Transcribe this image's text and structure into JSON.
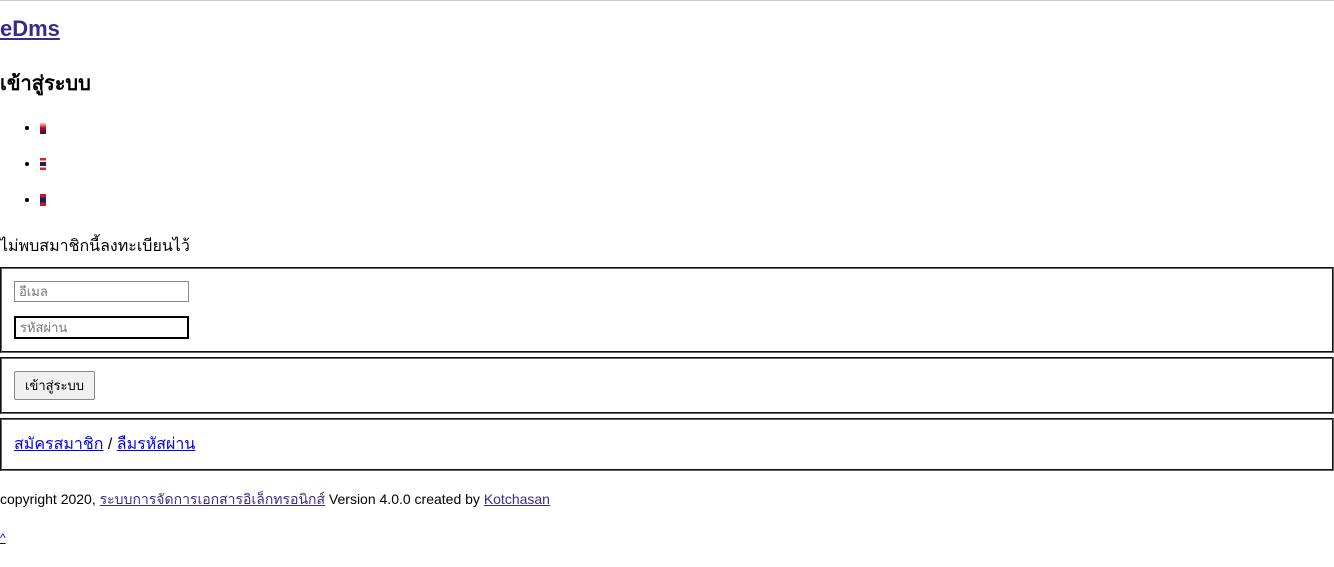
{
  "header": {
    "logo_text": "eDms",
    "page_title": "เข้าสู่ระบบ"
  },
  "languages": {
    "items": [
      {
        "name": "english",
        "flag": "flag-en"
      },
      {
        "name": "thai",
        "flag": "flag-th"
      },
      {
        "name": "lao",
        "flag": "flag-la"
      }
    ]
  },
  "error_message": "ไม่พบสมาชิกนี้ลงทะเบียนไว้",
  "form": {
    "email_placeholder": "อีเมล",
    "password_placeholder": "รหัสผ่าน",
    "login_button": "เข้าสู่ระบบ"
  },
  "links": {
    "register": "สมัครสมาชิก",
    "separator": " / ",
    "forgot": "ลืมรหัสผ่าน"
  },
  "footer": {
    "copyright_prefix": "copyright 2020, ",
    "system_name": "ระบบการจัดการเอกสารอิเล็กทรอนิกส์",
    "version_text": " Version 4.0.0 created by ",
    "author": "Kotchasan"
  },
  "caret": "^"
}
